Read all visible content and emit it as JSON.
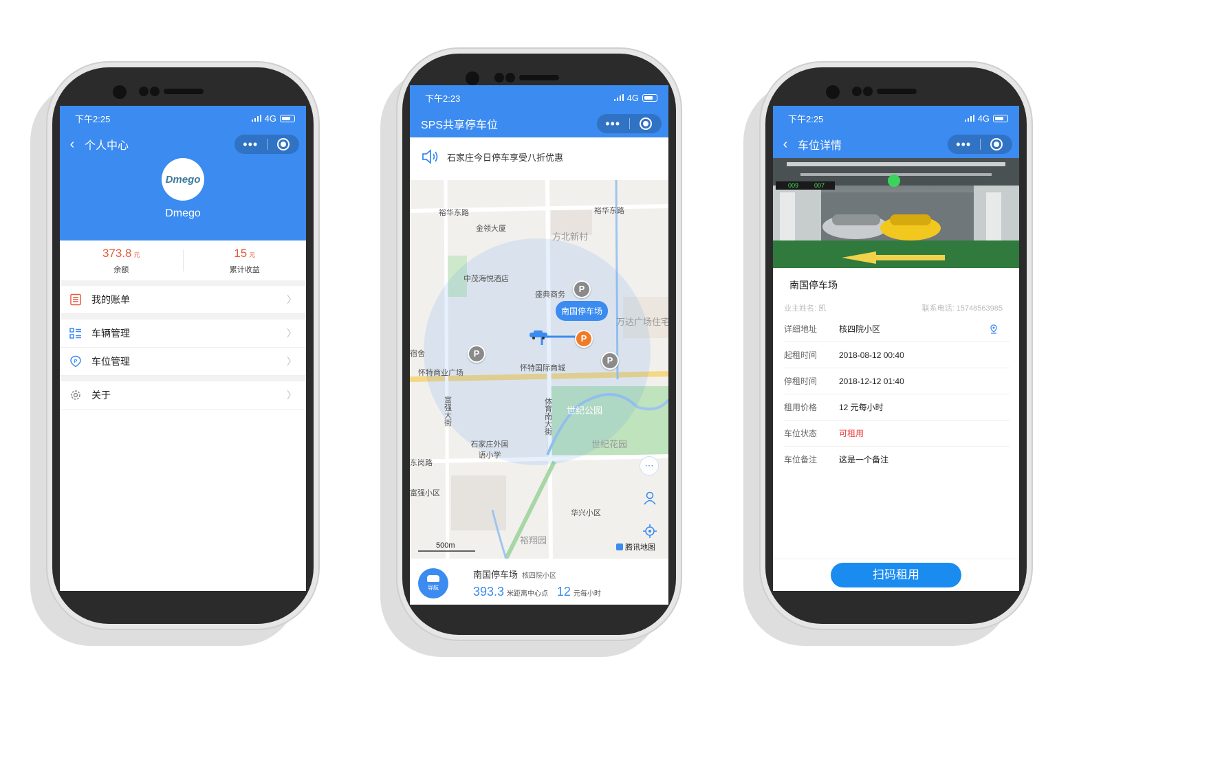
{
  "phone_profile": {
    "status": {
      "time": "下午2:25",
      "network": "4G"
    },
    "nav_title": "个人中心",
    "avatar_text": "Dmego",
    "username": "Dmego",
    "balance": {
      "value": "373.8",
      "unit": "元",
      "label": "余额"
    },
    "earnings": {
      "value": "15",
      "unit": "元",
      "label": "累计收益"
    },
    "menu": [
      {
        "label": "我的账单",
        "icon": "bill-icon",
        "color": "#e85a3c"
      },
      {
        "label": "车辆管理",
        "icon": "vehicle-list-icon",
        "color": "#3b8bf0"
      },
      {
        "label": "车位管理",
        "icon": "parking-location-icon",
        "color": "#3b8bf0"
      },
      {
        "label": "关于",
        "icon": "gear-icon",
        "color": "#888888"
      }
    ]
  },
  "phone_map": {
    "status": {
      "time": "下午2:23",
      "network": "4G"
    },
    "nav_title": "SPS共享停车位",
    "notice": "石家庄今日停车享受八折优惠",
    "map_labels": {
      "road1": "裕华东路",
      "road2": "裕华东路",
      "building1": "金领大厦",
      "area1": "方北新村",
      "hotel": "中茂海悦酒店",
      "biz": "盛典商务",
      "selected": "南国停车场",
      "plaza": "万达广场住宅",
      "mall1": "怀特商业广场",
      "mall2": "怀特国际商城",
      "park1": "世纪公园",
      "park2": "世纪花园",
      "school": "石家庄外国语小学",
      "street1": "富强大街",
      "street2": "体育南大街",
      "road3": "东岗路",
      "area2": "富强小区",
      "area3": "华兴小区",
      "area4": "裕翔园",
      "dorm": "宿舍",
      "scale": "500m",
      "provider": "腾讯地图"
    },
    "card": {
      "nav_label": "导航",
      "name": "南国停车场",
      "community": "核四院小区",
      "distance": "393.3",
      "distance_unit": "米距离中心点",
      "price": "12",
      "price_unit": "元每小时"
    }
  },
  "phone_detail": {
    "status": {
      "time": "下午2:25",
      "network": "4G"
    },
    "nav_title": "车位详情",
    "photo_signs": {
      "left": "009",
      "right": "007"
    },
    "lot_name": "南国停车场",
    "owner_name": "业主姓名: 凯",
    "owner_phone": "联系电话: 15748563985",
    "rows": [
      {
        "label": "详细地址",
        "value": "核四院小区"
      },
      {
        "label": "起租时间",
        "value": "2018-08-12 00:40"
      },
      {
        "label": "停租时间",
        "value": "2018-12-12 01:40"
      },
      {
        "label": "租用价格",
        "value": "12 元每小时"
      },
      {
        "label": "车位状态",
        "value": "可租用"
      },
      {
        "label": "车位备注",
        "value": "这是一个备注"
      }
    ],
    "button": "扫码租用"
  }
}
